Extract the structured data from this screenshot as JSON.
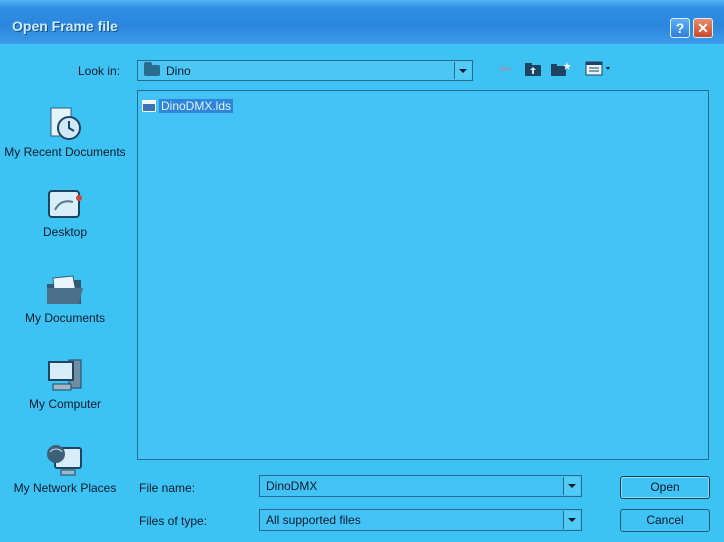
{
  "window": {
    "title": "Open Frame file",
    "help_symbol": "?",
    "close_symbol": "✕"
  },
  "lookin": {
    "label": "Look in:",
    "value": "Dino"
  },
  "toolbar": {
    "icons": [
      "back-arrow-icon",
      "up-one-level-icon",
      "create-new-folder-icon",
      "view-menu-icon"
    ]
  },
  "places": [
    {
      "label": "My Recent Documents",
      "icon": "recent-documents-icon"
    },
    {
      "label": "Desktop",
      "icon": "desktop-icon"
    },
    {
      "label": "My Documents",
      "icon": "my-documents-icon"
    },
    {
      "label": "My Computer",
      "icon": "my-computer-icon"
    },
    {
      "label": "My Network Places",
      "icon": "network-places-icon"
    }
  ],
  "files": [
    {
      "name": "DinoDMX.lds",
      "selected": true
    }
  ],
  "filename": {
    "label": "File name:",
    "value": "DinoDMX"
  },
  "filetype": {
    "label": "Files of type:",
    "value": "All supported files"
  },
  "buttons": {
    "open": "Open",
    "cancel": "Cancel"
  }
}
